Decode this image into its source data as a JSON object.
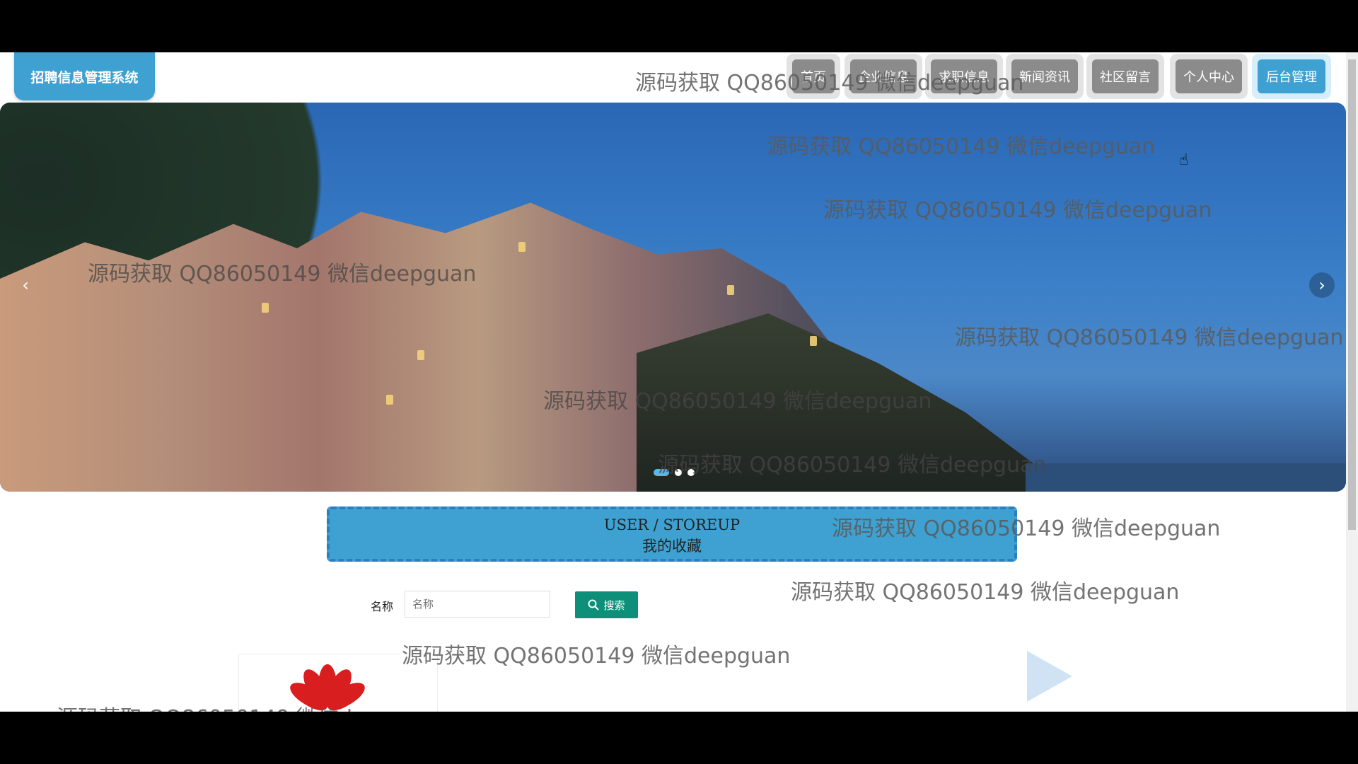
{
  "header": {
    "brand": "招聘信息管理系统",
    "nav": [
      {
        "label": "首页",
        "active": false
      },
      {
        "label": "企业信息",
        "active": false
      },
      {
        "label": "求职信息",
        "active": false
      },
      {
        "label": "新闻资讯",
        "active": false
      },
      {
        "label": "社区留言",
        "active": false
      },
      {
        "label": "个人中心",
        "active": false
      },
      {
        "label": "后台管理",
        "active": true
      }
    ]
  },
  "carousel": {
    "prev_icon": "chevron-left-icon",
    "next_icon": "chevron-right-icon",
    "slides": 3,
    "active_slide": 1
  },
  "section": {
    "title_en": "USER / STOREUP",
    "title_cn": "我的收藏"
  },
  "search": {
    "label": "名称",
    "placeholder": "名称",
    "button": "搜索",
    "button_icon": "search-icon"
  },
  "watermark": "源码获取 QQ86050149 微信deepguan",
  "colors": {
    "accent": "#3fa1d1",
    "search_button": "#0d8f7a",
    "nav_inactive": "#8b8b8b"
  }
}
